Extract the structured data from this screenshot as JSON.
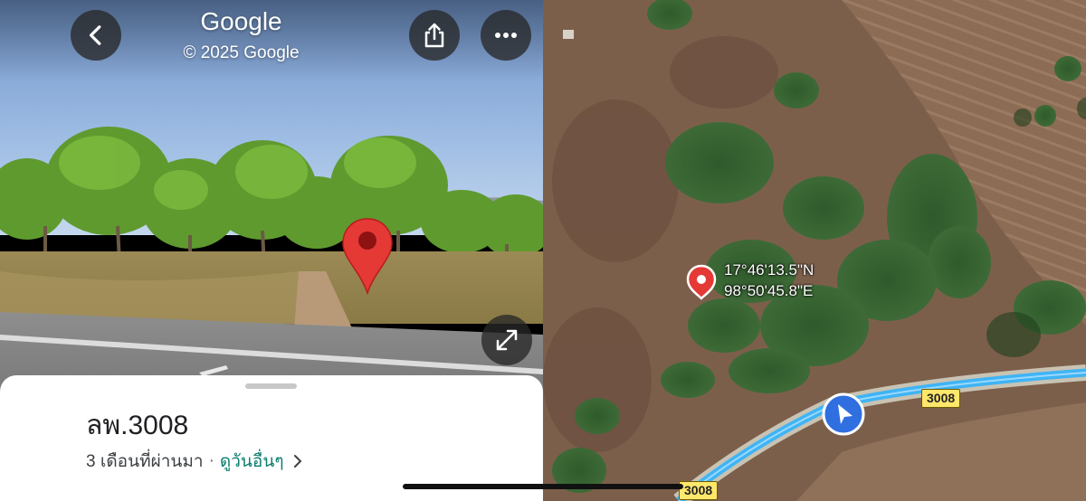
{
  "street_view": {
    "title": "Google",
    "copyright": "© 2025 Google",
    "buttons": {
      "back_icon": "chevron-left-icon",
      "share_icon": "share-icon",
      "more_icon": "more-horizontal-icon",
      "expand_icon": "expand-icon"
    },
    "pin_color": "#e53935"
  },
  "bottom_sheet": {
    "place_name": "ลพ.3008",
    "date_text": "3 เดือนที่ผ่านมา",
    "separator": "·",
    "other_dates_link": "ดูวันอื่นๆ"
  },
  "map": {
    "coords_lat": "17°46'13.5\"N",
    "coords_lon": "98°50'45.8\"E",
    "road_shields": [
      "3008",
      "3008"
    ],
    "route_color": "#3fb4f5",
    "location_arrow_color": "#2f6fe0"
  }
}
